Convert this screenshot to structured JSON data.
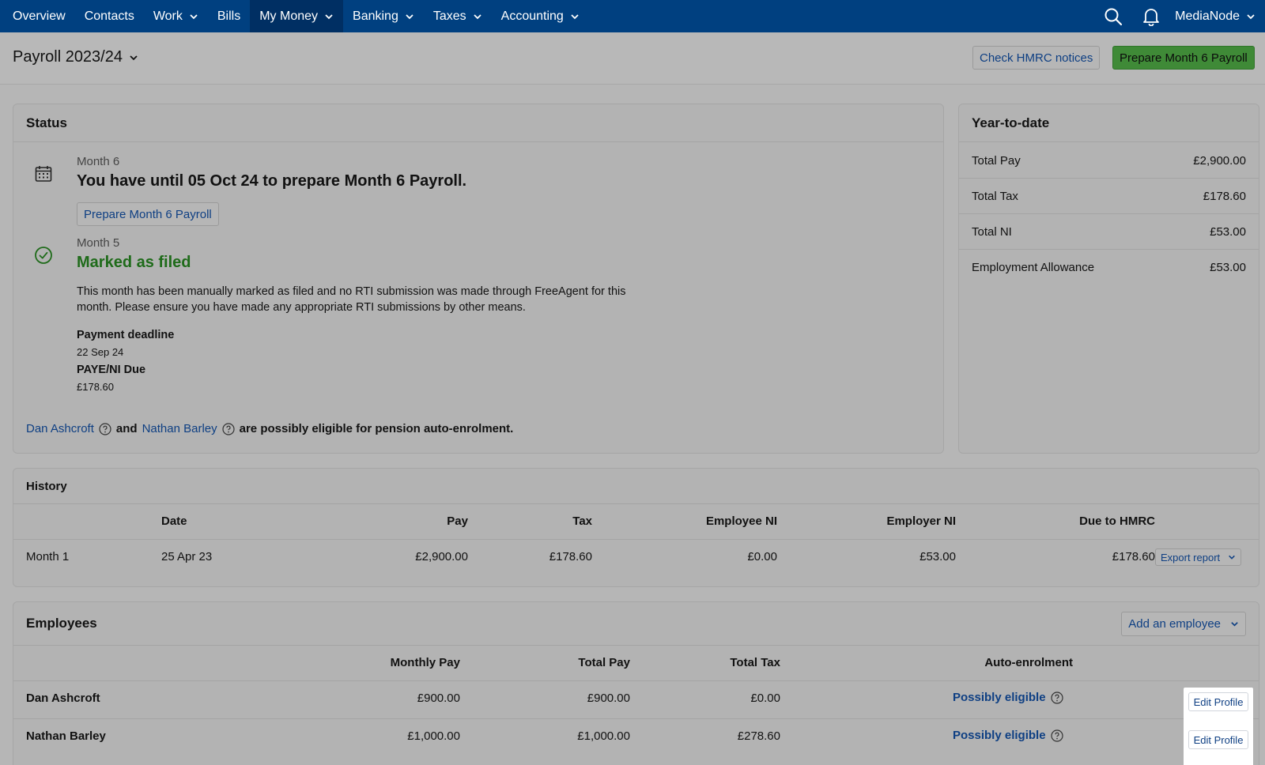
{
  "nav": {
    "items": [
      {
        "label": "Overview",
        "dropdown": false
      },
      {
        "label": "Contacts",
        "dropdown": false
      },
      {
        "label": "Work",
        "dropdown": true
      },
      {
        "label": "Bills",
        "dropdown": false
      },
      {
        "label": "My Money",
        "dropdown": true,
        "active": true
      },
      {
        "label": "Banking",
        "dropdown": true
      },
      {
        "label": "Taxes",
        "dropdown": true
      },
      {
        "label": "Accounting",
        "dropdown": true
      }
    ],
    "icons": [
      "search-icon",
      "bell-icon"
    ],
    "account": "MediaNode"
  },
  "header": {
    "title": "Payroll 2023/24",
    "check_hmrc": "Check HMRC notices",
    "prepare": "Prepare Month 6 Payroll"
  },
  "status": {
    "title": "Status",
    "upcoming": {
      "month": "Month 6",
      "headline": "You have until 05 Oct 24 to prepare Month 6 Payroll.",
      "button": "Prepare Month 6 Payroll",
      "icon": "calendar-icon"
    },
    "filed": {
      "month": "Month 5",
      "headline": "Marked as filed",
      "icon": "check-circle-icon",
      "body": "This month has been manually marked as filed and no RTI submission was made through FreeAgent for this month. Please ensure you have made any appropriate RTI submissions by other means.",
      "payment_deadline_label": "Payment deadline",
      "payment_deadline_value": "22 Sep 24",
      "paye_label": "PAYE/NI Due",
      "paye_value": "£178.60"
    },
    "pension": {
      "person1": "Dan Ashcroft",
      "and": "and",
      "person2": "Nathan Barley",
      "suffix": "are possibly eligible for pension auto-enrolment."
    }
  },
  "ytd": {
    "title": "Year-to-date",
    "rows": [
      {
        "label": "Total Pay",
        "value": "£2,900.00"
      },
      {
        "label": "Total Tax",
        "value": "£178.60"
      },
      {
        "label": "Total NI",
        "value": "£53.00"
      },
      {
        "label": "Employment Allowance",
        "value": "£53.00"
      }
    ]
  },
  "history": {
    "title": "History",
    "columns": {
      "date": "Date",
      "pay": "Pay",
      "tax": "Tax",
      "employee_ni": "Employee NI",
      "employer_ni": "Employer NI",
      "due": "Due to HMRC"
    },
    "rows": [
      {
        "month": "Month 1",
        "date": "25 Apr 23",
        "pay": "£2,900.00",
        "tax": "£178.60",
        "employee_ni": "£0.00",
        "employer_ni": "£53.00",
        "due": "£178.60",
        "action": "Export report"
      }
    ]
  },
  "employees": {
    "title": "Employees",
    "add_button": "Add an employee",
    "columns": {
      "monthly_pay": "Monthly Pay",
      "total_pay": "Total Pay",
      "total_tax": "Total Tax",
      "auto_enrolment": "Auto-enrolment"
    },
    "rows": [
      {
        "name": "Dan Ashcroft",
        "monthly_pay": "£900.00",
        "total_pay": "£900.00",
        "total_tax": "£0.00",
        "auto_enrolment": "Possibly eligible",
        "action": "Edit Profile"
      },
      {
        "name": "Nathan Barley",
        "monthly_pay": "£1,000.00",
        "total_pay": "£1,000.00",
        "total_tax": "£278.60",
        "auto_enrolment": "Possibly eligible",
        "action": "Edit Profile"
      }
    ]
  }
}
